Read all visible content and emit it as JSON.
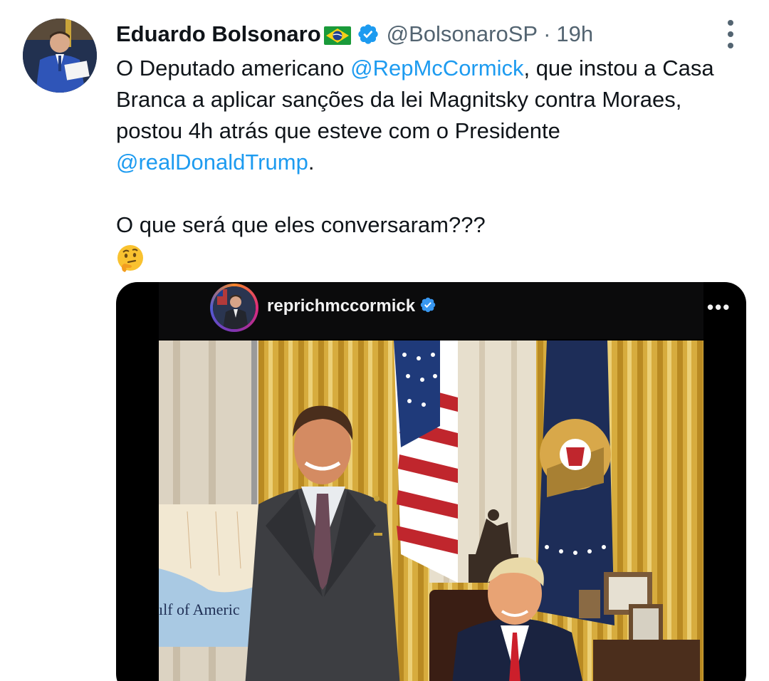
{
  "author": {
    "name": "Eduardo Bolsonaro",
    "flag_icon": "brazil-flag-emoji",
    "verified_icon": "verified-badge-icon",
    "handle": "@BolsonaroSP",
    "separator": "·",
    "time": "19h"
  },
  "tweet": {
    "line1_pre": "O Deputado americano ",
    "mention1": "@RepMcCormick",
    "line1_post": ", que instou a Casa Branca a aplicar sanções da lei Magnitsky contra Moraes, postou 4h atrás que esteve com o Presidente ",
    "mention2": "@realDonaldTrump",
    "line1_end": ".",
    "line2": "O que será que eles conversaram???",
    "emoji": "thinking-face-emoji"
  },
  "media": {
    "ig_username": "reprichmccormick",
    "ig_more": "•••",
    "map_label": "ılf of Americ"
  },
  "colors": {
    "link": "#1d9bf0",
    "secondary": "#536471",
    "verified": "#1d9bf0"
  }
}
